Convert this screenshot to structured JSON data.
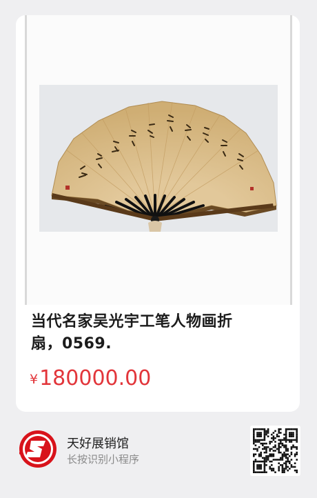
{
  "product": {
    "title_line1": "当代名家吴光宇工笔人物画折",
    "title_line2": "扇，0569.",
    "currency": "¥",
    "price": "180000.00",
    "image_icon": "folding-fan-photo"
  },
  "shop": {
    "name": "天好展销馆",
    "hint": "长按识别小程序",
    "logo_icon": "shop-logo-icon",
    "qr_icon": "mini-program-qr-code"
  },
  "colors": {
    "price": "#e2353a",
    "background": "#efeff1",
    "logo_red": "#d8131b"
  }
}
